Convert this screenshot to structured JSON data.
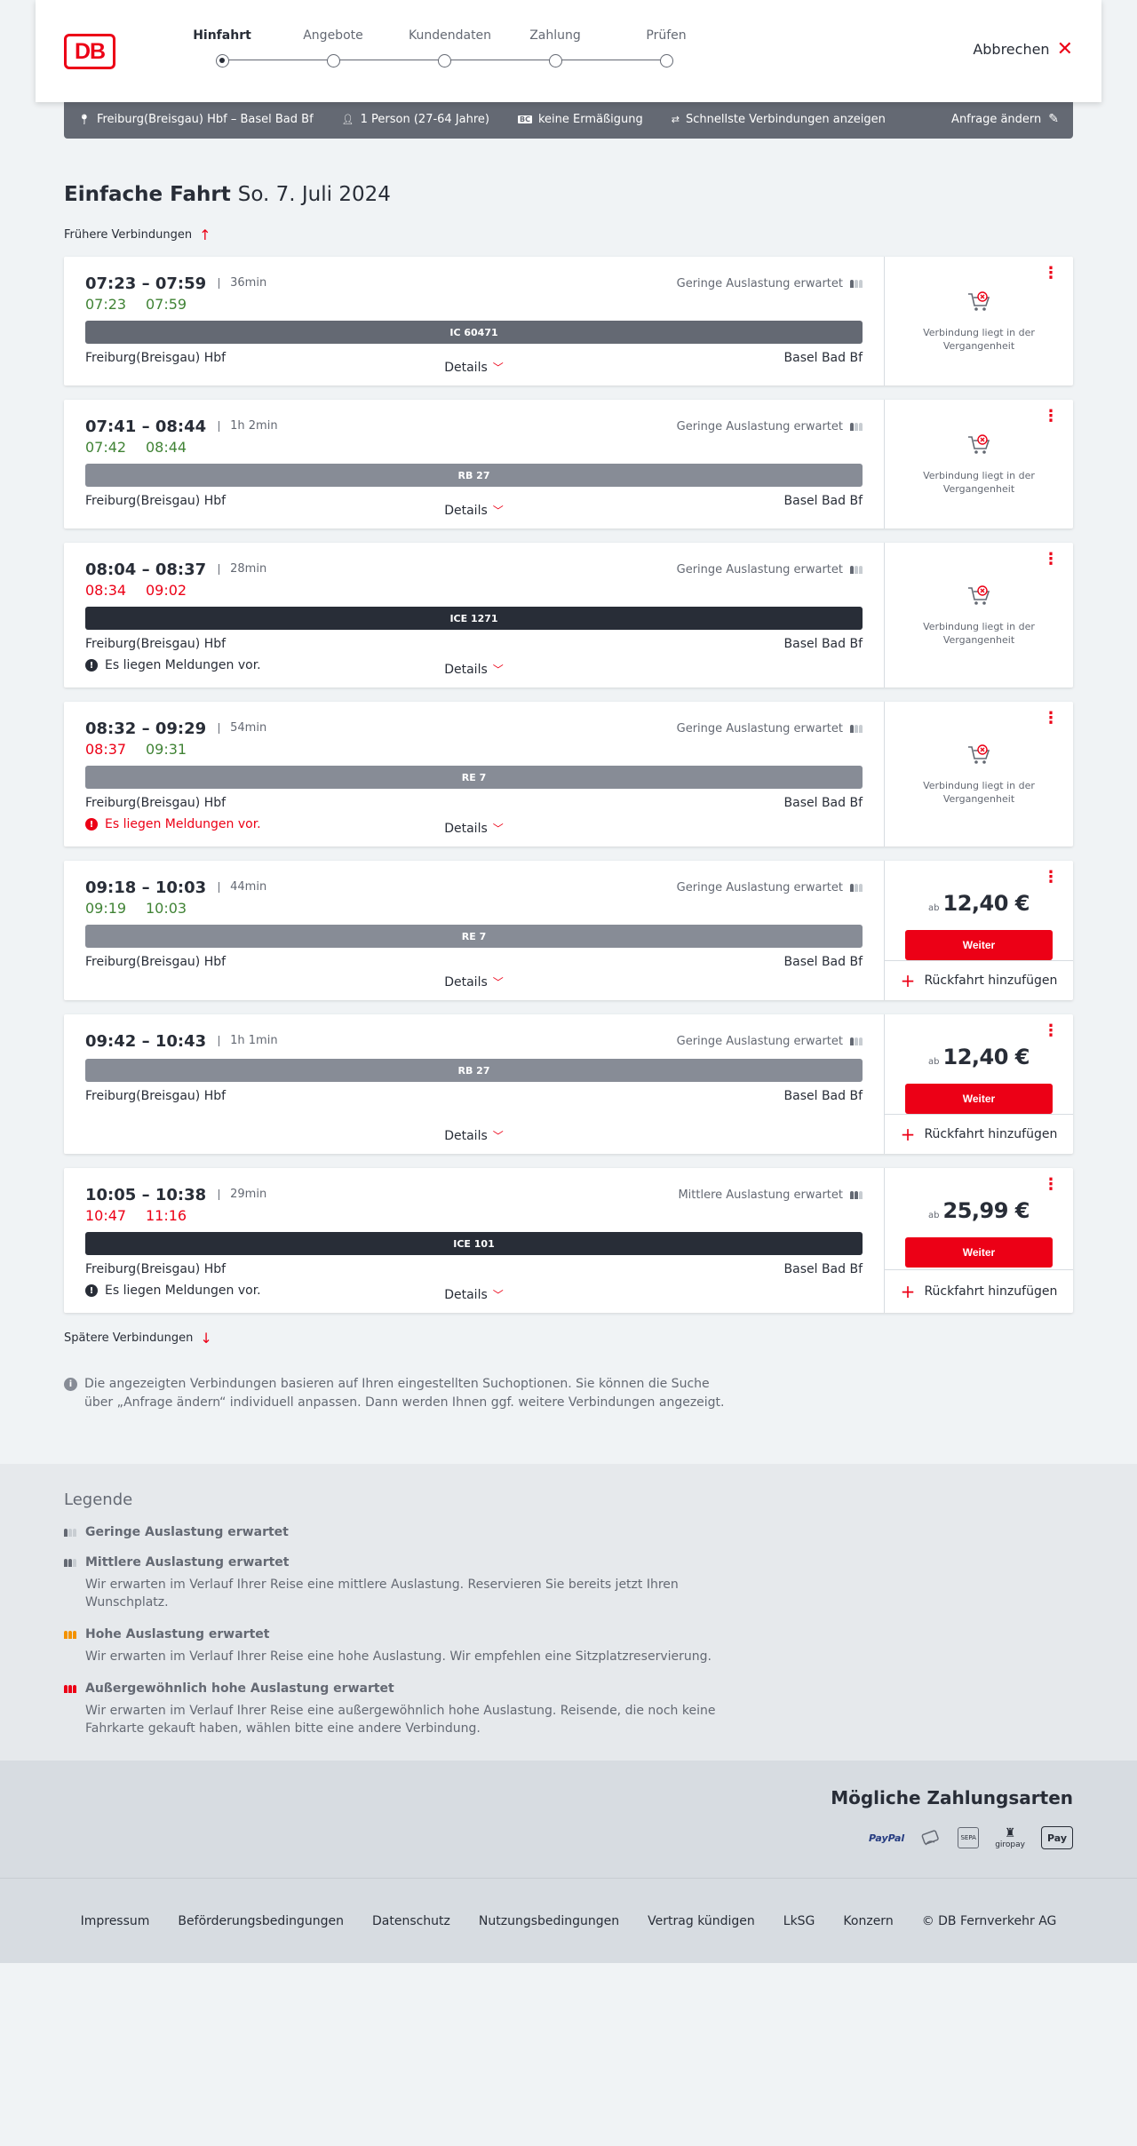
{
  "header": {
    "logo": "DB",
    "steps": [
      "Hinfahrt",
      "Angebote",
      "Kundendaten",
      "Zahlung",
      "Prüfen"
    ],
    "active_step": 0,
    "cancel_label": "Abbrechen"
  },
  "query": {
    "route": "Freiburg(Breisgau) Hbf – Basel Bad Bf",
    "passengers": "1 Person (27-64 Jahre)",
    "discount_badge": "BC",
    "discount": "keine Ermäßigung",
    "mode": "Schnellste Verbindungen anzeigen",
    "edit_label": "Anfrage ändern"
  },
  "page": {
    "title": "Einfache Fahrt",
    "date": "So. 7. Juli 2024",
    "earlier_label": "Frühere Verbindungen",
    "later_label": "Spätere Verbindungen",
    "info_text": "Die angezeigten Verbindungen basieren auf Ihren eingestellten Suchoptionen. Sie können die Suche über „Anfrage ändern“ individuell anpassen. Dann werden Ihnen ggf. weitere Verbindungen angezeigt."
  },
  "labels": {
    "details": "Details",
    "past": "Verbindung liegt in der Vergangenheit",
    "price_prefix": "ab",
    "continue": "Weiter",
    "add_return": "Rückfahrt hinzufügen"
  },
  "connections": [
    {
      "times": "07:23 – 07:59",
      "duration": "36min",
      "load": "Geringe Auslastung erwartet",
      "rt_dep": "07:23",
      "rt_arr": "07:59",
      "rt_dep_status": "green",
      "rt_arr_status": "green",
      "train": "IC 60471",
      "train_type": "ic",
      "from": "Freiburg(Breisgau) Hbf",
      "to": "Basel Bad Bf",
      "message": "",
      "message_status": "",
      "past": true,
      "price": ""
    },
    {
      "times": "07:41 – 08:44",
      "duration": "1h 2min",
      "load": "Geringe Auslastung erwartet",
      "rt_dep": "07:42",
      "rt_arr": "08:44",
      "rt_dep_status": "green",
      "rt_arr_status": "green",
      "train": "RB 27",
      "train_type": "rb",
      "from": "Freiburg(Breisgau) Hbf",
      "to": "Basel Bad Bf",
      "message": "",
      "message_status": "",
      "past": true,
      "price": ""
    },
    {
      "times": "08:04 – 08:37",
      "duration": "28min",
      "load": "Geringe Auslastung erwartet",
      "rt_dep": "08:34",
      "rt_arr": "09:02",
      "rt_dep_status": "red",
      "rt_arr_status": "red",
      "train": "ICE 1271",
      "train_type": "ice",
      "from": "Freiburg(Breisgau) Hbf",
      "to": "Basel Bad Bf",
      "message": "Es liegen Meldungen vor.",
      "message_status": "info",
      "past": true,
      "price": ""
    },
    {
      "times": "08:32 – 09:29",
      "duration": "54min",
      "load": "Geringe Auslastung erwartet",
      "rt_dep": "08:37",
      "rt_arr": "09:31",
      "rt_dep_status": "red",
      "rt_arr_status": "green",
      "train": "RE 7",
      "train_type": "re",
      "from": "Freiburg(Breisgau) Hbf",
      "to": "Basel Bad Bf",
      "message": "Es liegen Meldungen vor.",
      "message_status": "red",
      "past": true,
      "price": ""
    },
    {
      "times": "09:18 – 10:03",
      "duration": "44min",
      "load": "Geringe Auslastung erwartet",
      "rt_dep": "09:19",
      "rt_arr": "10:03",
      "rt_dep_status": "green",
      "rt_arr_status": "green",
      "train": "RE 7",
      "train_type": "re",
      "from": "Freiburg(Breisgau) Hbf",
      "to": "Basel Bad Bf",
      "message": "",
      "message_status": "",
      "past": false,
      "price": "12,40 €"
    },
    {
      "times": "09:42 – 10:43",
      "duration": "1h 1min",
      "load": "Geringe Auslastung erwartet",
      "rt_dep": "",
      "rt_arr": "",
      "rt_dep_status": "",
      "rt_arr_status": "",
      "train": "RB 27",
      "train_type": "rb",
      "from": "Freiburg(Breisgau) Hbf",
      "to": "Basel Bad Bf",
      "message": "",
      "message_status": "",
      "past": false,
      "price": "12,40 €"
    },
    {
      "times": "10:05 – 10:38",
      "duration": "29min",
      "load": "Mittlere Auslastung erwartet",
      "rt_dep": "10:47",
      "rt_arr": "11:16",
      "rt_dep_status": "red",
      "rt_arr_status": "red",
      "train": "ICE 101",
      "train_type": "ice",
      "from": "Freiburg(Breisgau) Hbf",
      "to": "Basel Bad Bf",
      "message": "Es liegen Meldungen vor.",
      "message_status": "info",
      "past": false,
      "price": "25,99 €"
    }
  ],
  "legend": {
    "title": "Legende",
    "items": [
      {
        "name": "Geringe Auslastung erwartet",
        "desc": "",
        "level": 1,
        "color": "#646973"
      },
      {
        "name": "Mittlere Auslastung erwartet",
        "desc": "Wir erwarten im Verlauf Ihrer Reise eine mittlere Auslastung. Reservieren Sie bereits jetzt Ihren Wunschplatz.",
        "level": 2,
        "color": "#646973"
      },
      {
        "name": "Hohe Auslastung erwartet",
        "desc": "Wir erwarten im Verlauf Ihrer Reise eine hohe Auslastung. Wir empfehlen eine Sitzplatzreservierung.",
        "level": 3,
        "color": "#f39200"
      },
      {
        "name": "Außergewöhnlich hohe Auslastung erwartet",
        "desc": "Wir erwarten im Verlauf Ihrer Reise eine außergewöhnlich hohe Auslastung. Reisende, die noch keine Fahrkarte gekauft haben, wählen bitte eine andere Verbindung.",
        "level": 4,
        "color": "#ec0016"
      }
    ]
  },
  "payment": {
    "title": "Mögliche Zahlungsarten",
    "methods": [
      "PayPal",
      "Kreditkarte",
      "SEPA",
      "giropay",
      "Apple Pay"
    ]
  },
  "footer": {
    "links": [
      "Impressum",
      "Beförderungsbedingungen",
      "Datenschutz",
      "Nutzungsbedingungen",
      "Vertrag kündigen",
      "LkSG",
      "Konzern",
      "© DB Fernverkehr AG"
    ]
  },
  "colors": {
    "accent": "#ec0016",
    "ontime": "#408335",
    "delayed": "#ec0016",
    "dark": "#282d37"
  }
}
